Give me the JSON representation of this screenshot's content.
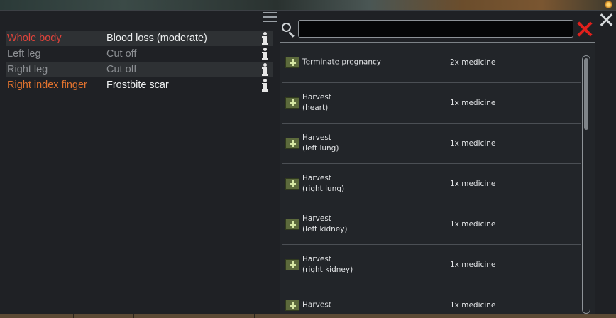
{
  "window": {
    "menu_icon": "hamburger-icon",
    "close_icon": "close-icon"
  },
  "health": {
    "rows": [
      {
        "part": "Whole body",
        "condition": "Blood loss (moderate)",
        "part_color": "#e0433b",
        "condition_color": "#eef0f1"
      },
      {
        "part": "Left leg",
        "condition": "Cut off",
        "part_color": "#8d9094",
        "condition_color": "#8d9094"
      },
      {
        "part": "Right leg",
        "condition": "Cut off",
        "part_color": "#8d9094",
        "condition_color": "#8d9094"
      },
      {
        "part": "Right index finger",
        "condition": "Frostbite scar",
        "part_color": "#e0722e",
        "condition_color": "#eef0f1"
      }
    ]
  },
  "search": {
    "value": "",
    "placeholder": ""
  },
  "operations": [
    {
      "name": "Terminate pregnancy",
      "cost": "2x medicine"
    },
    {
      "name": "Harvest\n(heart)",
      "cost": "1x medicine"
    },
    {
      "name": "Harvest\n(left lung)",
      "cost": "1x medicine"
    },
    {
      "name": "Harvest\n(right lung)",
      "cost": "1x medicine"
    },
    {
      "name": "Harvest\n(left kidney)",
      "cost": "1x medicine"
    },
    {
      "name": "Harvest\n(right kidney)",
      "cost": "1x medicine"
    },
    {
      "name": "Harvest",
      "cost": "1x medicine"
    }
  ],
  "colors": {
    "accent_red": "#e0201c",
    "panel": "#1f2125"
  }
}
